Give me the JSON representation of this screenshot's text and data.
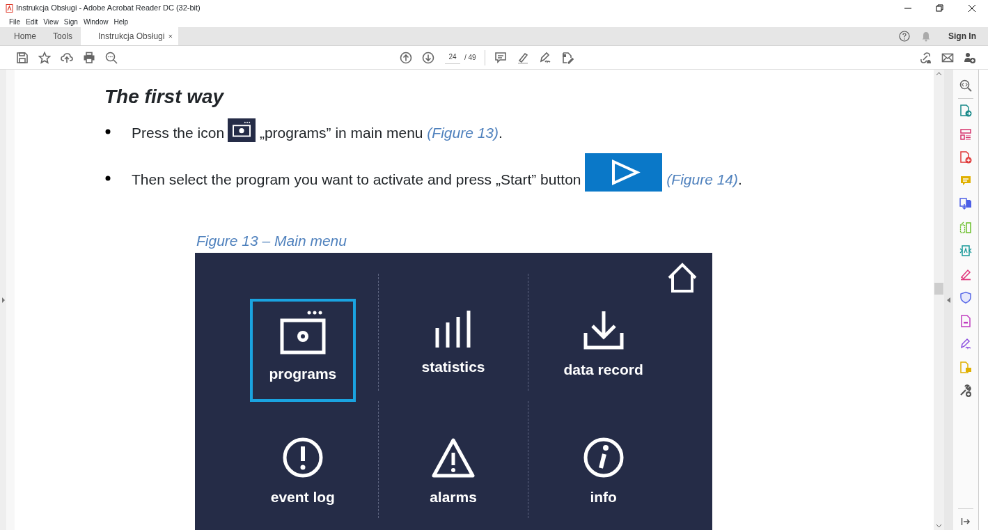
{
  "window": {
    "title": "Instrukcja Obsługi - Adobe Acrobat Reader DC (32-bit)"
  },
  "menu": [
    "File",
    "Edit",
    "View",
    "Sign",
    "Window",
    "Help"
  ],
  "tabs": [
    {
      "label": "Home",
      "selected": false
    },
    {
      "label": "Tools",
      "selected": false
    },
    {
      "label": "Instrukcja Obsługi",
      "selected": true
    }
  ],
  "sign_in": "Sign In",
  "page_nav": {
    "current": "24",
    "total": "/ 49"
  },
  "document": {
    "heading": "The first way",
    "bullets": [
      [
        {
          "kind": "text",
          "text": "Press the icon"
        },
        {
          "kind": "programs"
        },
        {
          "kind": "text",
          "text": " „programs” in main menu "
        },
        {
          "kind": "ref",
          "text": "(Figure 13)"
        },
        {
          "kind": "text",
          "text": "."
        }
      ],
      [
        {
          "kind": "text",
          "text": "Then select the program you want to activate and press „Start” button "
        },
        {
          "kind": "play"
        },
        {
          "kind": "ref",
          "text": "(Figure 14)"
        },
        {
          "kind": "text",
          "text": "."
        }
      ]
    ],
    "figure": {
      "caption": "Figure 13 – Main menu",
      "tiles": [
        {
          "kind": "programs",
          "label": "programs",
          "selected": true
        },
        {
          "kind": "statistics",
          "label": "statistics",
          "selected": false
        },
        {
          "kind": "download",
          "label": "data record",
          "selected": false
        },
        {
          "kind": "event",
          "label": "event log",
          "selected": false
        },
        {
          "kind": "alarm",
          "label": "alarms",
          "selected": false
        },
        {
          "kind": "info",
          "label": "info",
          "selected": false
        }
      ]
    }
  }
}
